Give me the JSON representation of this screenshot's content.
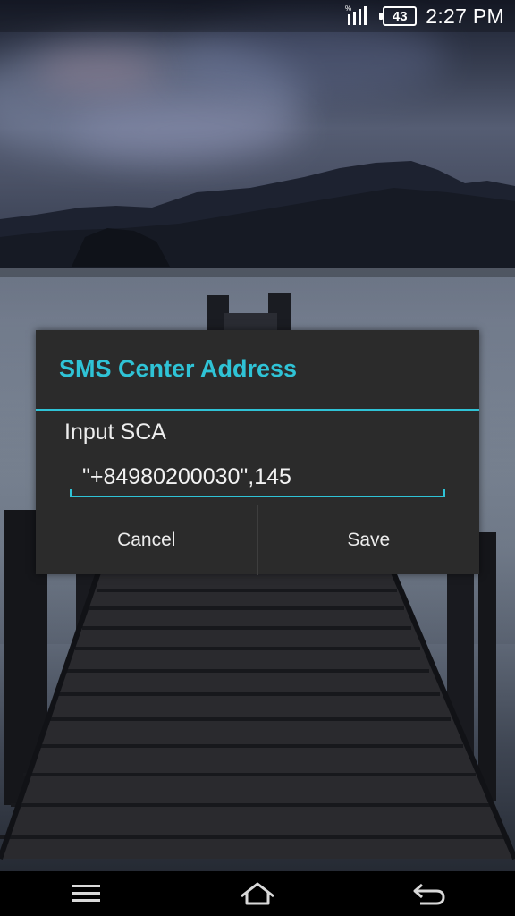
{
  "status_bar": {
    "battery_level": "43",
    "time": "2:27 PM",
    "signal_icon": "signal-bars-icon",
    "battery_icon": "battery-icon"
  },
  "dialog": {
    "title": "SMS Center Address",
    "input_label": "Input SCA",
    "input_value": "\"+84980200030\",145",
    "cancel_label": "Cancel",
    "save_label": "Save",
    "accent_color": "#2fc3d6"
  },
  "nav_bar": {
    "menu_icon": "menu-icon",
    "home_icon": "home-icon",
    "back_icon": "back-icon"
  }
}
